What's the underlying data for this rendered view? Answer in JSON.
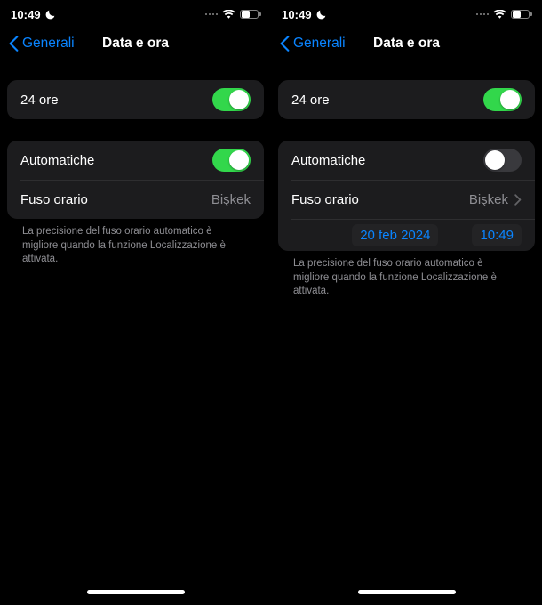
{
  "panels": [
    {
      "status_bar": {
        "time": "10:49",
        "moon_icon": "crescent-moon-icon",
        "signal_icon": "signal-dots-icon",
        "wifi_icon": "wifi-icon",
        "battery_icon": "battery-icon",
        "battery_level_percent": 45
      },
      "nav": {
        "back_icon": "chevron-left-icon",
        "back_label": "Generali",
        "title": "Data e ora"
      },
      "format_card": {
        "rows": [
          {
            "label": "24 ore",
            "control": "toggle",
            "state": "on"
          }
        ]
      },
      "timezone_card": {
        "rows": [
          {
            "label": "Automatiche",
            "control": "toggle",
            "state": "on"
          },
          {
            "label": "Fuso orario",
            "value": "Bişkek",
            "control": "value",
            "chevron": false
          }
        ],
        "datetime_row": null
      },
      "footer": "La precisione del fuso orario automatico è migliore quando la funzione Localizzazione è attivata.",
      "home_indicator": "home-indicator"
    },
    {
      "status_bar": {
        "time": "10:49",
        "moon_icon": "crescent-moon-icon",
        "signal_icon": "signal-dots-icon",
        "wifi_icon": "wifi-icon",
        "battery_icon": "battery-icon",
        "battery_level_percent": 45
      },
      "nav": {
        "back_icon": "chevron-left-icon",
        "back_label": "Generali",
        "title": "Data e ora"
      },
      "format_card": {
        "rows": [
          {
            "label": "24 ore",
            "control": "toggle",
            "state": "on"
          }
        ]
      },
      "timezone_card": {
        "rows": [
          {
            "label": "Automatiche",
            "control": "toggle",
            "state": "off"
          },
          {
            "label": "Fuso orario",
            "value": "Bişkek",
            "control": "value",
            "chevron": true
          }
        ],
        "datetime_row": {
          "date": "20 feb 2024",
          "time": "10:49"
        }
      },
      "footer": "La precisione del fuso orario automatico è migliore quando la funzione Localizzazione è attivata.",
      "home_indicator": "home-indicator"
    }
  ],
  "colors": {
    "background": "#000000",
    "card": "#1c1c1e",
    "accent_blue": "#0a84ff",
    "toggle_on_green": "#32d74b",
    "toggle_off_gray": "#39393d",
    "secondary_text": "#8e8e93",
    "separator": "#2e2e30"
  }
}
